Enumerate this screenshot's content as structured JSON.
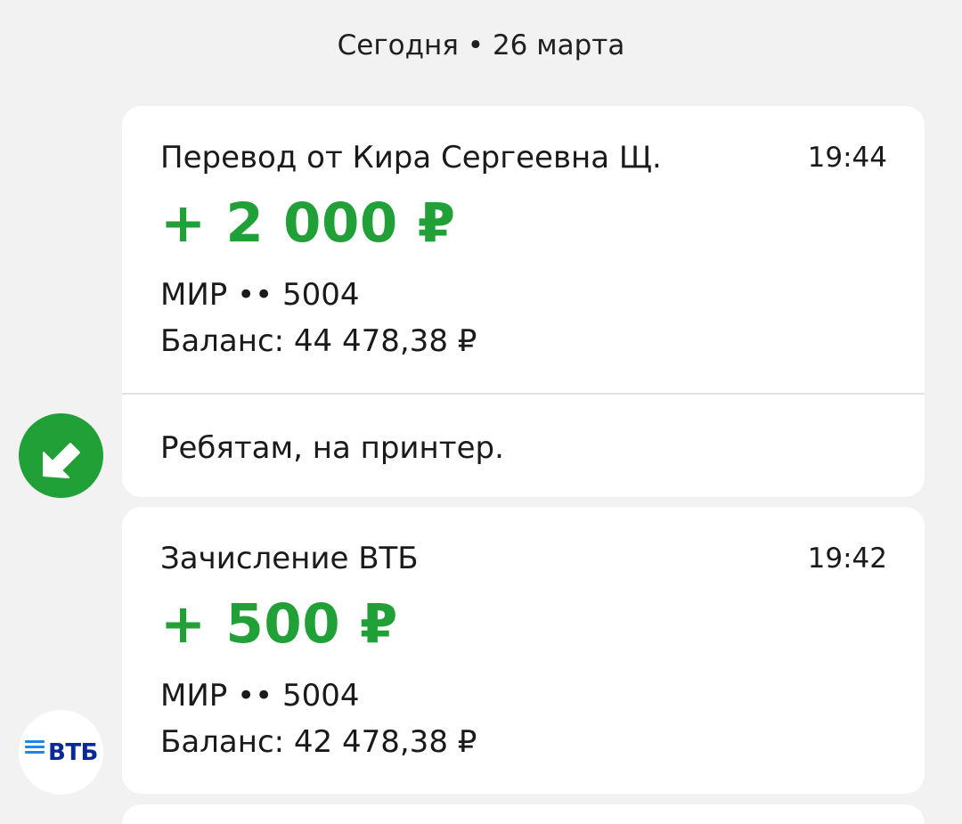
{
  "date_header": "Сегодня • 26 марта",
  "transactions": [
    {
      "title": "Перевод от Кира Сергеевна Щ.",
      "time": "19:44",
      "amount": "+ 2 000 ₽",
      "card": "МИР •• 5004",
      "balance": "Баланс: 44 478,38 ₽",
      "message": "Ребятам, на принтер.",
      "icon": "incoming-arrow-icon"
    },
    {
      "title": "Зачисление ВТБ",
      "time": "19:42",
      "amount": "+ 500 ₽",
      "card": "МИР •• 5004",
      "balance": "Баланс: 42 478,38 ₽",
      "icon": "vtb-logo"
    }
  ],
  "bank_logo": "ВТБ",
  "colors": {
    "amount_green": "#21a038",
    "background": "#f2f2f2",
    "card": "#ffffff",
    "vtb_blue": "#0a2896"
  }
}
